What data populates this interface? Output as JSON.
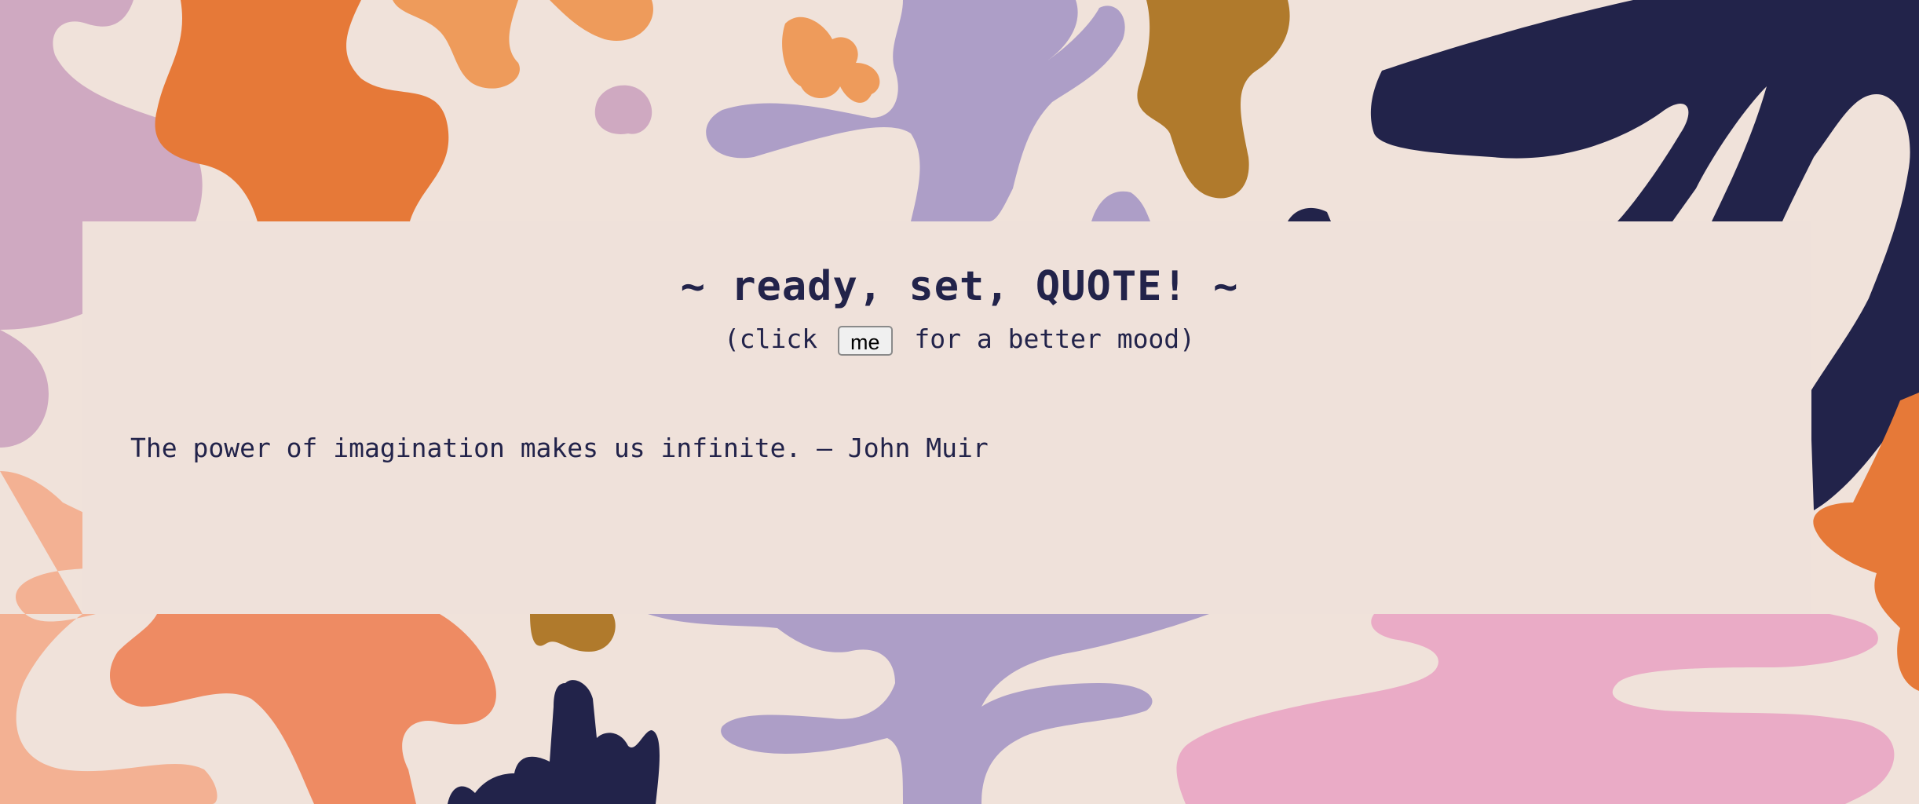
{
  "header": {
    "title": "~ ready, set, QUOTE! ~",
    "subtitle_prefix": "(click",
    "button_label": "me",
    "subtitle_suffix": "for a better mood)"
  },
  "quote": {
    "text": "The power of imagination makes us infinite. – John Muir"
  },
  "colors": {
    "background": "#f0e2da",
    "card": "#efe1da",
    "text": "#22234a",
    "orange": "#e67938",
    "light_orange": "#ee9b5b",
    "peach": "#f3b193",
    "lavender": "#ad9ec7",
    "mauve": "#cfa9c1",
    "ochre": "#b07a2c",
    "navy": "#22234a",
    "pink": "#eaabc6",
    "salmon": "#ee8b63"
  }
}
